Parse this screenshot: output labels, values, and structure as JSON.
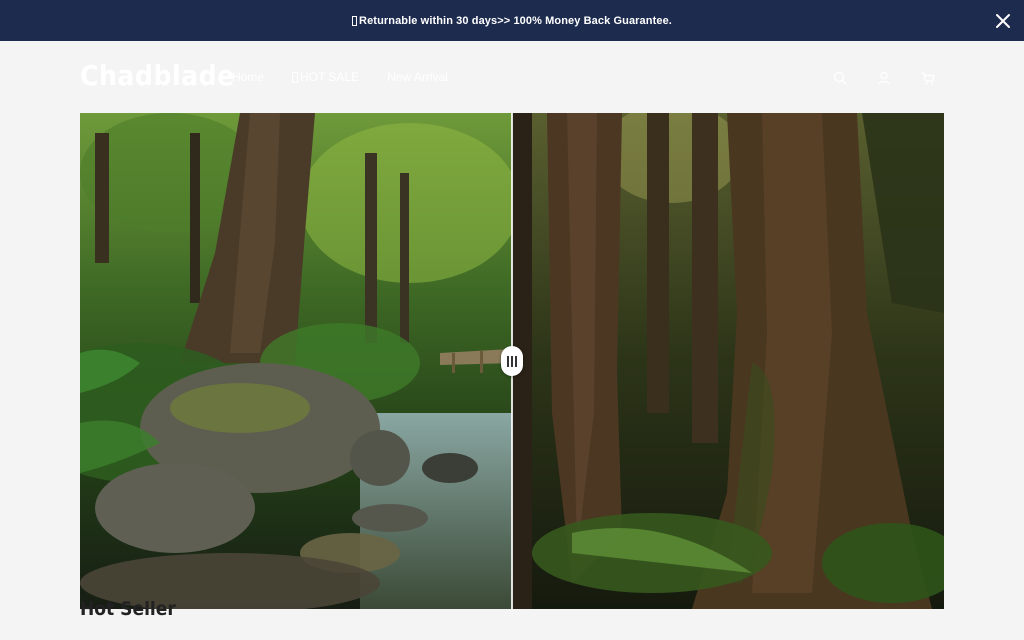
{
  "announcement": {
    "text": "Returnable within 30 days>> 100% Money Back Guarantee."
  },
  "header": {
    "logo": "Chadblade",
    "nav": [
      {
        "label": "Home"
      },
      {
        "label": "HOT SALE"
      },
      {
        "label": "New Arrival"
      }
    ],
    "icons": [
      "search-icon",
      "account-icon",
      "cart-icon"
    ]
  },
  "hero": {
    "left_image": "forest stream with mossy rocks and wooden bridge",
    "right_image": "tall rainforest tree trunks with ferns",
    "slider_position": 0.5
  },
  "section": {
    "title": "Hot Seller"
  },
  "colors": {
    "announcement_bg": "#1d2b4f",
    "page_bg": "#f4f4f4"
  }
}
